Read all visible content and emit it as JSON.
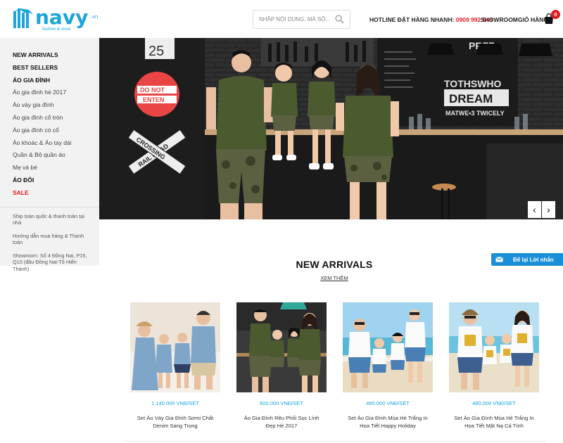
{
  "header": {
    "logo_text": "navy",
    "logo_domain": ".vn",
    "logo_tagline": "fashion & more",
    "search_placeholder": "NHẬP NỘI DUNG, MÃ SỐ...",
    "hotline_label": "HOTLINE ĐẶT HÀNG NHANH:",
    "hotline_number": "0909 992 048",
    "showroom_label": "SHOWROOM",
    "cart_label": "GIỎ HÀNG",
    "cart_count": "0",
    "accent_color": "#1aa5dd",
    "sale_color": "#e31b23"
  },
  "sidebar": {
    "menu": [
      {
        "label": "NEW ARRIVALS",
        "style": "bold"
      },
      {
        "label": "BEST SELLERS",
        "style": "bold"
      },
      {
        "label": "ÁO GIA ĐÌNH",
        "style": "bold"
      },
      {
        "label": "Áo gia đình hè 2017",
        "style": "normal"
      },
      {
        "label": "Áo váy gia đình",
        "style": "normal"
      },
      {
        "label": "Áo gia đình cổ tròn",
        "style": "normal"
      },
      {
        "label": "Áo gia đình có cổ",
        "style": "normal"
      },
      {
        "label": "Áo khoác & Áo tay dài",
        "style": "normal"
      },
      {
        "label": "Quần & Bộ quần áo",
        "style": "normal"
      },
      {
        "label": "Mẹ và bé",
        "style": "normal"
      },
      {
        "label": "ÁO ĐÔI",
        "style": "bold"
      },
      {
        "label": "SALE",
        "style": "sale"
      }
    ],
    "info": [
      "Ship toàn quốc & thanh toán tại nhà",
      "Hướng dẫn mua hàng & Thanh toán",
      "Showroom: Số 4 Đồng Nai, P15, Q10 (đầu Đồng Nai-Tô Hiến Thành)"
    ]
  },
  "banner": {
    "sign_number": "25",
    "sign_do_not": "DO NOT",
    "sign_enter": "ENTEN",
    "sign_railroad": "RAIL ROAD",
    "sign_crossing": "CROSSING",
    "board_text_1": "TOTHSWHO",
    "board_text_2": "DREAM",
    "board_text_3": "MATWE•3 TWICELY",
    "board_text_4": "PRFF",
    "prev_icon": "‹",
    "next_icon": "›"
  },
  "feedback": {
    "label": "Để lại Lời nhắn"
  },
  "new_arrivals": {
    "title": "NEW ARRIVALS",
    "view_more": "XEM THÊM",
    "products": [
      {
        "price": "1.140.000 VNĐ/SET",
        "name": "Set Áo Váy Gia Đình Sơmi Chất Denim Sang Trọng"
      },
      {
        "price": "600.000 VNĐ/SET",
        "name": "Áo Gia Đình Rêu Phối Sọc Lính Đẹp Hè 2017"
      },
      {
        "price": "480.000 VNĐ/SET",
        "name": "Set Áo Gia Đình Mùa Hè Trắng In Họa Tiết Happy Holiday"
      },
      {
        "price": "480.000 VNĐ/SET",
        "name": "Set Áo Gia Đình Mùa Hè Trắng In Họa Tiết Mặt Nạ Cá Tính"
      }
    ]
  }
}
